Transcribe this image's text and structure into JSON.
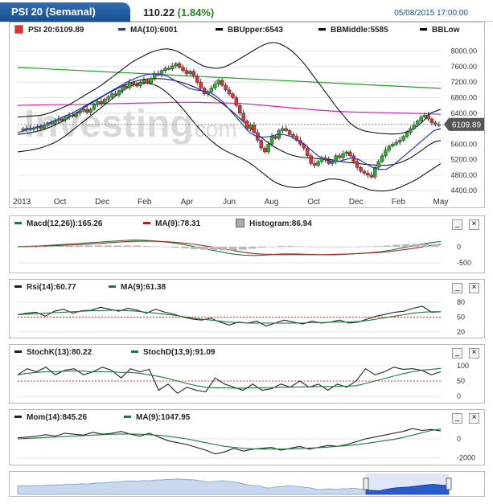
{
  "header": {
    "symbol_tab": "PSI 20 (Semanal)",
    "price": "110.22",
    "change": "(1.84%)",
    "datetime": "05/08/2015 17:00:00"
  },
  "main_panel": {
    "legend": [
      {
        "label": "PSI 20:6109.89",
        "color": "#e53030",
        "kind": "square"
      },
      {
        "label": "MA(10):6001",
        "color": "#2035d0",
        "kind": "line"
      },
      {
        "label": "BBUpper:6543",
        "color": "#000000",
        "kind": "line"
      },
      {
        "label": "BBMiddle:5585",
        "color": "#000000",
        "kind": "line"
      },
      {
        "label": "BBLow",
        "color": "#000000",
        "kind": "line"
      }
    ],
    "last_price_label": "6109.89",
    "watermark_main": "Investing",
    "watermark_suffix": ".com"
  },
  "macd_panel": {
    "legend": [
      {
        "label": "Macd(12,26)):165.26",
        "color": "#1a7a3a"
      },
      {
        "label": "MA(9):78.31",
        "color": "#b02020"
      },
      {
        "label": "Histogram:86.94",
        "color": "#999999",
        "kind": "box"
      }
    ],
    "minimize_label": "_",
    "close_label": "×"
  },
  "rsi_panel": {
    "legend": [
      {
        "label": "Rsi(14):60.77",
        "color": "#222222"
      },
      {
        "label": "MA(9):61.38",
        "color": "#1a7a3a"
      }
    ],
    "minimize_label": "_",
    "close_label": "×"
  },
  "stoch_panel": {
    "legend": [
      {
        "label": "StochK(13):80.22",
        "color": "#222222"
      },
      {
        "label": "StochD(13,9):91.09",
        "color": "#1a7a3a"
      }
    ],
    "minimize_label": "_",
    "close_label": "×"
  },
  "mom_panel": {
    "legend": [
      {
        "label": "Mom(14):845.26",
        "color": "#222222"
      },
      {
        "label": "MA(9):1047.95",
        "color": "#1a7a3a"
      }
    ],
    "minimize_label": "_",
    "close_label": "×"
  },
  "chart_data": [
    {
      "type": "candlestick",
      "title": "PSI 20 (Semanal)",
      "x_ticks": [
        "2013",
        "Oct",
        "Dec",
        "Feb",
        "Apr",
        "Jun",
        "Aug",
        "Oct",
        "Dec",
        "Feb",
        "May"
      ],
      "y_ticks": [
        8000,
        7600,
        7200,
        6800,
        6400,
        6000,
        5600,
        5200,
        4800,
        4400
      ],
      "ylim": [
        4300,
        8200
      ],
      "close": [
        5970,
        5990,
        6010,
        5980,
        6020,
        6050,
        6010,
        6080,
        6150,
        6120,
        6200,
        6250,
        6230,
        6300,
        6350,
        6320,
        6400,
        6450,
        6500,
        6420,
        6500,
        6620,
        6700,
        6650,
        6760,
        6820,
        6900,
        6870,
        6980,
        7100,
        7060,
        7200,
        7150,
        7100,
        7200,
        7250,
        7180,
        7300,
        7420,
        7380,
        7500,
        7560,
        7540,
        7620,
        7680,
        7580,
        7500,
        7420,
        7480,
        7350,
        7200,
        7050,
        6900,
        6950,
        7050,
        7150,
        7250,
        7120,
        7000,
        6900,
        6800,
        6600,
        6400,
        6200,
        6000,
        6100,
        5900,
        5700,
        5500,
        5400,
        5600,
        5800,
        5750,
        5950,
        6000,
        5950,
        5850,
        5800,
        5700,
        5600,
        5500,
        5300,
        5100,
        5050,
        5150,
        5250,
        5200,
        5100,
        5150,
        5300,
        5250,
        5350,
        5400,
        5300,
        5150,
        5000,
        4900,
        4850,
        4800,
        4750,
        5000,
        5150,
        5300,
        5450,
        5550,
        5600,
        5650,
        5700,
        5800,
        5900,
        6000,
        6100,
        6200,
        6300,
        6350,
        6250,
        6150,
        6100,
        6110
      ],
      "bb_upper": [
        6300,
        6310,
        6320,
        6330,
        6340,
        6360,
        6400,
        6450,
        6500,
        6560,
        6620,
        6700,
        6780,
        6860,
        6940,
        7020,
        7100,
        7200,
        7300,
        7400,
        7500,
        7600,
        7700,
        7780,
        7850,
        7920,
        7980,
        8020,
        8050,
        8060,
        8040,
        7990,
        7920,
        7840,
        7760,
        7680,
        7620,
        7580,
        7560,
        7560,
        7590,
        7650,
        7720,
        7800,
        7880,
        7960,
        8040,
        8120,
        8180,
        8220,
        8220,
        8180,
        8110,
        8020,
        7900,
        7760,
        7600,
        7420,
        7240,
        7060,
        6880,
        6700,
        6520,
        6360,
        6200,
        6080,
        6000,
        5950,
        5920,
        5900,
        5880,
        5870,
        5860,
        5860,
        5870,
        5900,
        5950,
        6020,
        6120,
        6250,
        6400,
        6450,
        6500
      ],
      "bb_middle": [
        5850,
        5870,
        5890,
        5920,
        5960,
        6010,
        6070,
        6140,
        6220,
        6310,
        6410,
        6510,
        6610,
        6700,
        6790,
        6880,
        6960,
        7040,
        7110,
        7170,
        7220,
        7260,
        7280,
        7290,
        7290,
        7280,
        7260,
        7230,
        7190,
        7140,
        7080,
        7010,
        6930,
        6840,
        6740,
        6630,
        6510,
        6380,
        6240,
        6100,
        5960,
        5830,
        5710,
        5600,
        5500,
        5420,
        5350,
        5300,
        5270,
        5250,
        5240,
        5230,
        5220,
        5210,
        5180,
        5150,
        5130,
        5120,
        5100,
        5080,
        5070,
        5060,
        5050,
        5060,
        5080,
        5120,
        5180,
        5260,
        5360,
        5470,
        5580,
        5660,
        5700
      ],
      "bb_lower": [
        5400,
        5420,
        5440,
        5470,
        5510,
        5560,
        5620,
        5700,
        5800,
        5920,
        6040,
        6160,
        6280,
        6400,
        6520,
        6640,
        6760,
        6880,
        6990,
        7080,
        7150,
        7180,
        7180,
        7150,
        7080,
        6980,
        6850,
        6700,
        6530,
        6350,
        6160,
        5980,
        5820,
        5680,
        5560,
        5460,
        5380,
        5310,
        5240,
        5160,
        5060,
        4940,
        4820,
        4700,
        4600,
        4540,
        4500,
        4480,
        4480,
        4500,
        4560,
        4620,
        4660,
        4700,
        4700,
        4680,
        4640,
        4580,
        4520,
        4470,
        4420,
        4400,
        4390,
        4400,
        4430,
        4480,
        4550,
        4620,
        4700,
        4800,
        4900,
        5000,
        5100
      ],
      "ma10": [
        5900,
        5950,
        6000,
        6050,
        6100,
        6180,
        6250,
        6330,
        6400,
        6500,
        6600,
        6700,
        6800,
        6900,
        7000,
        7100,
        7200,
        7280,
        7350,
        7400,
        7420,
        7400,
        7350,
        7250,
        7150,
        7050,
        7000,
        6980,
        6950,
        6850,
        6700,
        6500,
        6300,
        6100,
        5900,
        5800,
        5780,
        5800,
        5850,
        5850,
        5800,
        5700,
        5600,
        5450,
        5300,
        5200,
        5150,
        5150,
        5200,
        5250,
        5200,
        5100,
        5000,
        4950,
        4950,
        5050,
        5200,
        5350,
        5500,
        5650,
        5800,
        5950,
        6001
      ],
      "sma_green": [
        7580,
        7550,
        7520,
        7490,
        7460,
        7430,
        7400,
        7370,
        7340,
        7310,
        7280,
        7250,
        7220,
        7190,
        7160,
        7130,
        7100,
        7070,
        7040
      ],
      "sma_magenta": [
        6600,
        6610,
        6620,
        6620,
        6630,
        6640,
        6650,
        6660,
        6670,
        6680,
        6680,
        6670,
        6660,
        6640,
        6600,
        6560,
        6520,
        6480,
        6450,
        6430,
        6420,
        6410,
        6400,
        6390,
        6370
      ]
    },
    {
      "type": "line",
      "title": "Macd(12,26))",
      "y_ticks": [
        0,
        -500
      ],
      "ylim": [
        -700,
        400
      ],
      "series": [
        {
          "name": "Macd(12,26))",
          "values": [
            10,
            15,
            25,
            40,
            60,
            80,
            100,
            120,
            140,
            160,
            180,
            200,
            210,
            200,
            180,
            150,
            110,
            60,
            0,
            -60,
            -120,
            -180,
            -230,
            -260,
            -270,
            -260,
            -240,
            -220,
            -220,
            -230,
            -240,
            -250,
            -250,
            -240,
            -220,
            -200,
            -180,
            -150,
            -100,
            -40,
            20,
            80,
            130,
            165
          ]
        },
        {
          "name": "MA(9)",
          "values": [
            0,
            5,
            10,
            20,
            35,
            50,
            65,
            80,
            100,
            120,
            140,
            160,
            170,
            175,
            170,
            160,
            140,
            110,
            75,
            30,
            -20,
            -70,
            -120,
            -170,
            -210,
            -230,
            -240,
            -245,
            -245,
            -245,
            -245,
            -245,
            -240,
            -230,
            -220,
            -205,
            -190,
            -170,
            -140,
            -100,
            -60,
            -10,
            40,
            78
          ]
        },
        {
          "name": "Histogram",
          "values": [
            10,
            10,
            15,
            20,
            25,
            30,
            35,
            40,
            40,
            40,
            40,
            40,
            40,
            25,
            10,
            -10,
            -30,
            -50,
            -75,
            -90,
            -100,
            -110,
            -110,
            -90,
            -60,
            -30,
            0,
            25,
            25,
            15,
            5,
            -5,
            -10,
            -10,
            0,
            5,
            10,
            20,
            40,
            60,
            80,
            90,
            90,
            87
          ]
        }
      ]
    },
    {
      "type": "line",
      "title": "Rsi(14)",
      "y_ticks": [
        80,
        50,
        20
      ],
      "ylim": [
        15,
        90
      ],
      "series": [
        {
          "name": "Rsi(14)",
          "values": [
            55,
            58,
            60,
            52,
            62,
            66,
            58,
            63,
            64,
            70,
            66,
            62,
            68,
            64,
            58,
            66,
            60,
            56,
            50,
            46,
            44,
            48,
            40,
            34,
            40,
            38,
            42,
            32,
            38,
            44,
            40,
            36,
            42,
            38,
            40,
            44,
            38,
            40,
            46,
            52,
            56,
            60,
            62,
            68,
            72,
            60,
            61
          ]
        },
        {
          "name": "MA(9)",
          "values": [
            55,
            56,
            57,
            58,
            59,
            60,
            61,
            62,
            63,
            63,
            64,
            64,
            63,
            62,
            60,
            58,
            56,
            54,
            51,
            48,
            46,
            44,
            42,
            40,
            39,
            38,
            38,
            38,
            38,
            38,
            38,
            38,
            39,
            39,
            40,
            40,
            40,
            41,
            43,
            46,
            49,
            52,
            55,
            58,
            60,
            61,
            61
          ]
        }
      ]
    },
    {
      "type": "line",
      "title": "StochK(13)",
      "y_ticks": [
        100,
        50,
        0
      ],
      "ylim": [
        -10,
        110
      ],
      "series": [
        {
          "name": "StochK(13)",
          "values": [
            70,
            90,
            80,
            95,
            70,
            85,
            90,
            70,
            80,
            95,
            85,
            60,
            90,
            80,
            88,
            20,
            40,
            10,
            30,
            20,
            15,
            60,
            40,
            30,
            20,
            40,
            20,
            25,
            40,
            30,
            50,
            30,
            40,
            20,
            40,
            30,
            50,
            90,
            70,
            80,
            95,
            88,
            90,
            85,
            70,
            80
          ]
        },
        {
          "name": "StochD(13,9)",
          "values": [
            70,
            75,
            78,
            80,
            80,
            82,
            83,
            82,
            80,
            80,
            80,
            78,
            78,
            75,
            70,
            65,
            58,
            50,
            42,
            35,
            30,
            28,
            28,
            27,
            27,
            28,
            28,
            29,
            30,
            30,
            31,
            31,
            32,
            32,
            33,
            33,
            35,
            42,
            50,
            58,
            66,
            74,
            80,
            85,
            88,
            91
          ]
        }
      ]
    },
    {
      "type": "line",
      "title": "Mom(14)",
      "y_ticks": [
        0,
        -2000
      ],
      "ylim": [
        -2400,
        1200
      ],
      "series": [
        {
          "name": "Mom(14)",
          "values": [
            100,
            200,
            300,
            450,
            300,
            600,
            500,
            400,
            700,
            500,
            600,
            800,
            500,
            300,
            600,
            200,
            -200,
            -400,
            -600,
            -900,
            -1200,
            -1600,
            -1400,
            -1000,
            -1300,
            -1100,
            -1000,
            -900,
            -1200,
            -1000,
            -800,
            -1100,
            -900,
            -700,
            -800,
            -600,
            -300,
            0,
            200,
            400,
            600,
            800,
            1100,
            900,
            1000,
            845
          ]
        },
        {
          "name": "MA(9)",
          "values": [
            0,
            50,
            100,
            150,
            200,
            250,
            300,
            350,
            400,
            450,
            500,
            520,
            520,
            500,
            450,
            380,
            280,
            150,
            0,
            -200,
            -400,
            -600,
            -800,
            -900,
            -1000,
            -1050,
            -1080,
            -1080,
            -1070,
            -1050,
            -1020,
            -980,
            -930,
            -870,
            -800,
            -720,
            -620,
            -500,
            -350,
            -200,
            -50,
            150,
            400,
            650,
            900,
            1048
          ]
        }
      ]
    }
  ]
}
